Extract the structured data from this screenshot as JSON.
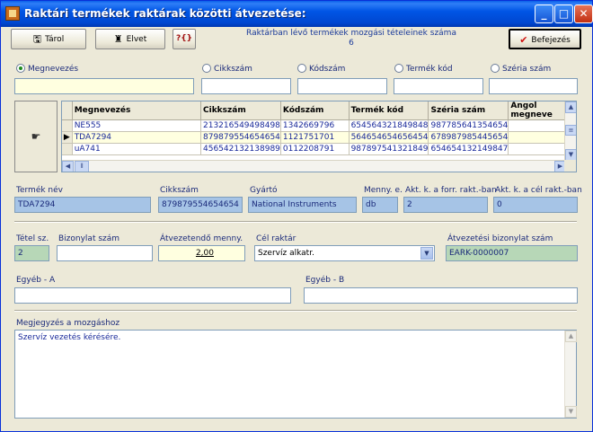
{
  "window": {
    "title": "Raktári termékek raktárak közötti átvezetése:"
  },
  "toolbar": {
    "store_label": "Tárol",
    "discard_label": "Elvet",
    "help_label": "?{}",
    "finish_label": "Befejezés"
  },
  "movements": {
    "label": "Raktárban lévő termékek mozgási tételeinek száma",
    "count": "6"
  },
  "search": {
    "options": [
      {
        "label": "Megnevezés",
        "selected": true
      },
      {
        "label": "Cikkszám",
        "selected": false
      },
      {
        "label": "Kódszám",
        "selected": false
      },
      {
        "label": "Termék kód",
        "selected": false
      },
      {
        "label": "Széria szám",
        "selected": false
      }
    ]
  },
  "grid": {
    "columns": [
      "Megnevezés",
      "Cikkszám",
      "Kódszám",
      "Termék kód",
      "Széria szám",
      "Angol megneve"
    ],
    "rows": [
      [
        "NE555",
        "213216549498498",
        "1342669796",
        "654564321849848",
        "987785641354654",
        ""
      ],
      [
        "TDA7294",
        "879879554654654",
        "1121751701",
        "564654654656454",
        "678987985445654",
        ""
      ],
      [
        "uA741",
        "456542132138989",
        "0112208791",
        "987897541321849",
        "654654132149847",
        ""
      ]
    ],
    "selected_row": 1
  },
  "details": {
    "product_name_label": "Termék név",
    "product_name": "TDA7294",
    "item_number_label": "Cikkszám",
    "item_number": "879879554654654",
    "manufacturer_label": "Gyártó",
    "manufacturer": "National Instruments",
    "unit_label": "Menny. e.",
    "unit": "db",
    "source_stock_label": "Akt. k. a forr. rakt.-ban",
    "source_stock": "2",
    "target_stock_label": "Akt. k. a cél  rakt.-ban",
    "target_stock": "0"
  },
  "transfer": {
    "line_no_label": "Tétel sz.",
    "line_no": "2",
    "voucher_label": "Bizonylat szám",
    "voucher": "",
    "qty_label": "Átvezetendő menny.",
    "qty": "2,00",
    "target_wh_label": "Cél raktár",
    "target_wh": "Szervíz alkatr.",
    "transfer_voucher_label": "Átvezetési bizonylat szám",
    "transfer_voucher": "EARK-0000007"
  },
  "other": {
    "a_label": "Egyéb - A",
    "a_value": "",
    "b_label": "Egyéb - B",
    "b_value": ""
  },
  "note": {
    "label": "Megjegyzés a mozgáshoz",
    "text": "Szervíz vezetés kérésére."
  }
}
